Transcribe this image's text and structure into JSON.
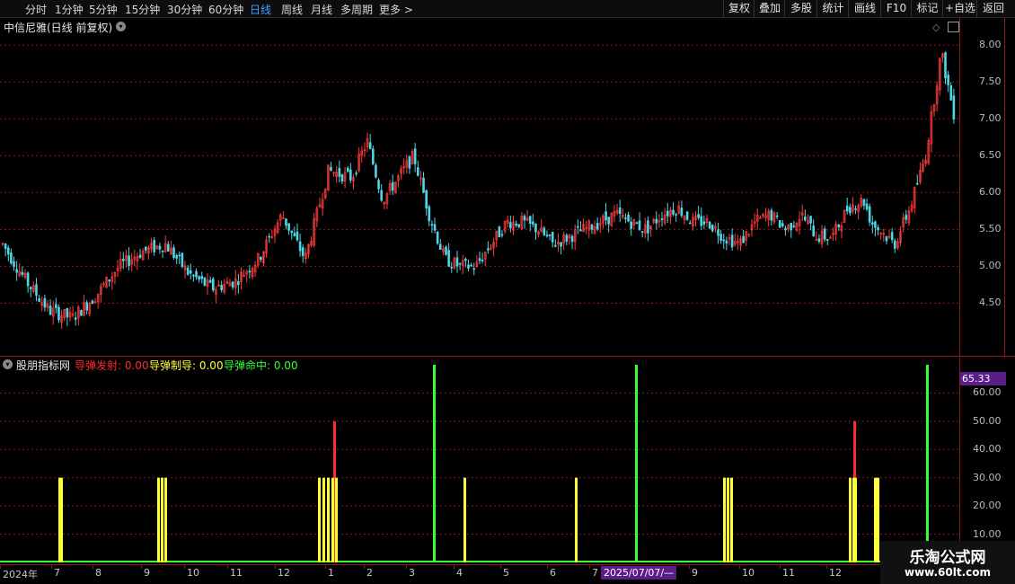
{
  "toolbar": {
    "periods": [
      "分时",
      "1分钟",
      "5分钟",
      "15分钟",
      "30分钟",
      "60分钟",
      "日线",
      "周线",
      "月线",
      "多周期",
      "更多 >"
    ],
    "active_period": "日线",
    "right_buttons": [
      "复权",
      "叠加",
      "多股",
      "统计",
      "画线",
      "F10",
      "标记",
      "+自选",
      "返回"
    ]
  },
  "price_panel": {
    "title": "中信尼雅(日线 前复权)",
    "y_ticks": [
      "8.00",
      "7.50",
      "7.00",
      "6.50",
      "6.00",
      "5.50",
      "5.00",
      "4.50"
    ],
    "colors": {
      "up": "#ff3b3b",
      "down": "#4fd7e6",
      "grid": "#8b1a1a"
    }
  },
  "indicator_panel": {
    "name": "股朋指标网",
    "lines": [
      {
        "label": "导弹发射: 0.00",
        "color": "#ff2a2a"
      },
      {
        "label": "导弹制导: 0.00",
        "color": "#ffff33"
      },
      {
        "label": "导弹命中: 0.00",
        "color": "#33ff33"
      }
    ],
    "top_value": "65.33",
    "y_ticks": [
      "60.00",
      "50.00",
      "40.00",
      "30.00",
      "20.00",
      "10.00"
    ]
  },
  "x_axis": {
    "labels": [
      "2024年",
      "7",
      "8",
      "9",
      "10",
      "11",
      "12",
      "1",
      "2",
      "3",
      "4",
      "5",
      "6",
      "7",
      "9",
      "10",
      "11",
      "12"
    ],
    "cursor_date": "2025/07/07/—"
  },
  "watermark": {
    "line1": "乐淘公式网",
    "line2": "www.60lt.com"
  },
  "chart_data": [
    {
      "type": "candlestick",
      "title": "中信尼雅(日线 前复权)",
      "ylim": [
        4.2,
        8.1
      ],
      "close_path_points": [
        [
          0,
          5.3
        ],
        [
          15,
          4.8
        ],
        [
          30,
          4.4
        ],
        [
          45,
          4.3
        ],
        [
          60,
          4.6
        ],
        [
          75,
          5.0
        ],
        [
          90,
          5.2
        ],
        [
          105,
          5.3
        ],
        [
          120,
          4.9
        ],
        [
          135,
          4.7
        ],
        [
          150,
          4.8
        ],
        [
          165,
          5.1
        ],
        [
          180,
          5.7
        ],
        [
          195,
          5.1
        ],
        [
          210,
          6.3
        ],
        [
          225,
          6.2
        ],
        [
          235,
          6.7
        ],
        [
          245,
          5.9
        ],
        [
          255,
          6.2
        ],
        [
          265,
          6.5
        ],
        [
          275,
          5.7
        ],
        [
          285,
          5.1
        ],
        [
          295,
          5.0
        ],
        [
          305,
          5.0
        ],
        [
          315,
          5.3
        ],
        [
          325,
          5.6
        ],
        [
          335,
          5.6
        ],
        [
          345,
          5.5
        ],
        [
          355,
          5.3
        ],
        [
          365,
          5.4
        ],
        [
          375,
          5.5
        ],
        [
          385,
          5.6
        ],
        [
          395,
          5.7
        ],
        [
          405,
          5.6
        ],
        [
          415,
          5.5
        ],
        [
          425,
          5.7
        ],
        [
          435,
          5.8
        ],
        [
          445,
          5.6
        ],
        [
          455,
          5.6
        ],
        [
          465,
          5.4
        ],
        [
          475,
          5.3
        ],
        [
          485,
          5.6
        ],
        [
          495,
          5.7
        ],
        [
          505,
          5.5
        ],
        [
          515,
          5.7
        ],
        [
          525,
          5.4
        ],
        [
          535,
          5.4
        ],
        [
          545,
          5.8
        ],
        [
          555,
          5.9
        ],
        [
          560,
          5.6
        ],
        [
          565,
          5.5
        ],
        [
          575,
          5.3
        ],
        [
          585,
          5.8
        ],
        [
          595,
          6.5
        ],
        [
          605,
          7.9
        ],
        [
          615,
          6.9
        ]
      ]
    },
    {
      "type": "bar",
      "series": [
        {
          "name": "导弹发射",
          "color": "#ff2a2a",
          "values": [
            [
              372,
              50
            ],
            [
              951,
              50
            ]
          ]
        },
        {
          "name": "导弹制导",
          "color": "#ffff33",
          "values": [
            [
              66,
              30
            ],
            [
              68,
              30
            ],
            [
              176,
              30
            ],
            [
              180,
              30
            ],
            [
              184,
              30
            ],
            [
              355,
              30
            ],
            [
              360,
              30
            ],
            [
              365,
              30
            ],
            [
              370,
              30
            ],
            [
              374,
              30
            ],
            [
              517,
              30
            ],
            [
              641,
              30
            ],
            [
              806,
              30
            ],
            [
              810,
              30
            ],
            [
              814,
              30
            ],
            [
              946,
              30
            ],
            [
              950,
              30
            ],
            [
              952,
              30
            ],
            [
              974,
              30
            ],
            [
              977,
              30
            ]
          ]
        },
        {
          "name": "导弹命中",
          "color": "#33ff33",
          "values": [
            [
              483,
              70
            ],
            [
              708,
              70
            ],
            [
              1032,
              70
            ]
          ]
        }
      ],
      "ylim": [
        0,
        70
      ]
    }
  ]
}
